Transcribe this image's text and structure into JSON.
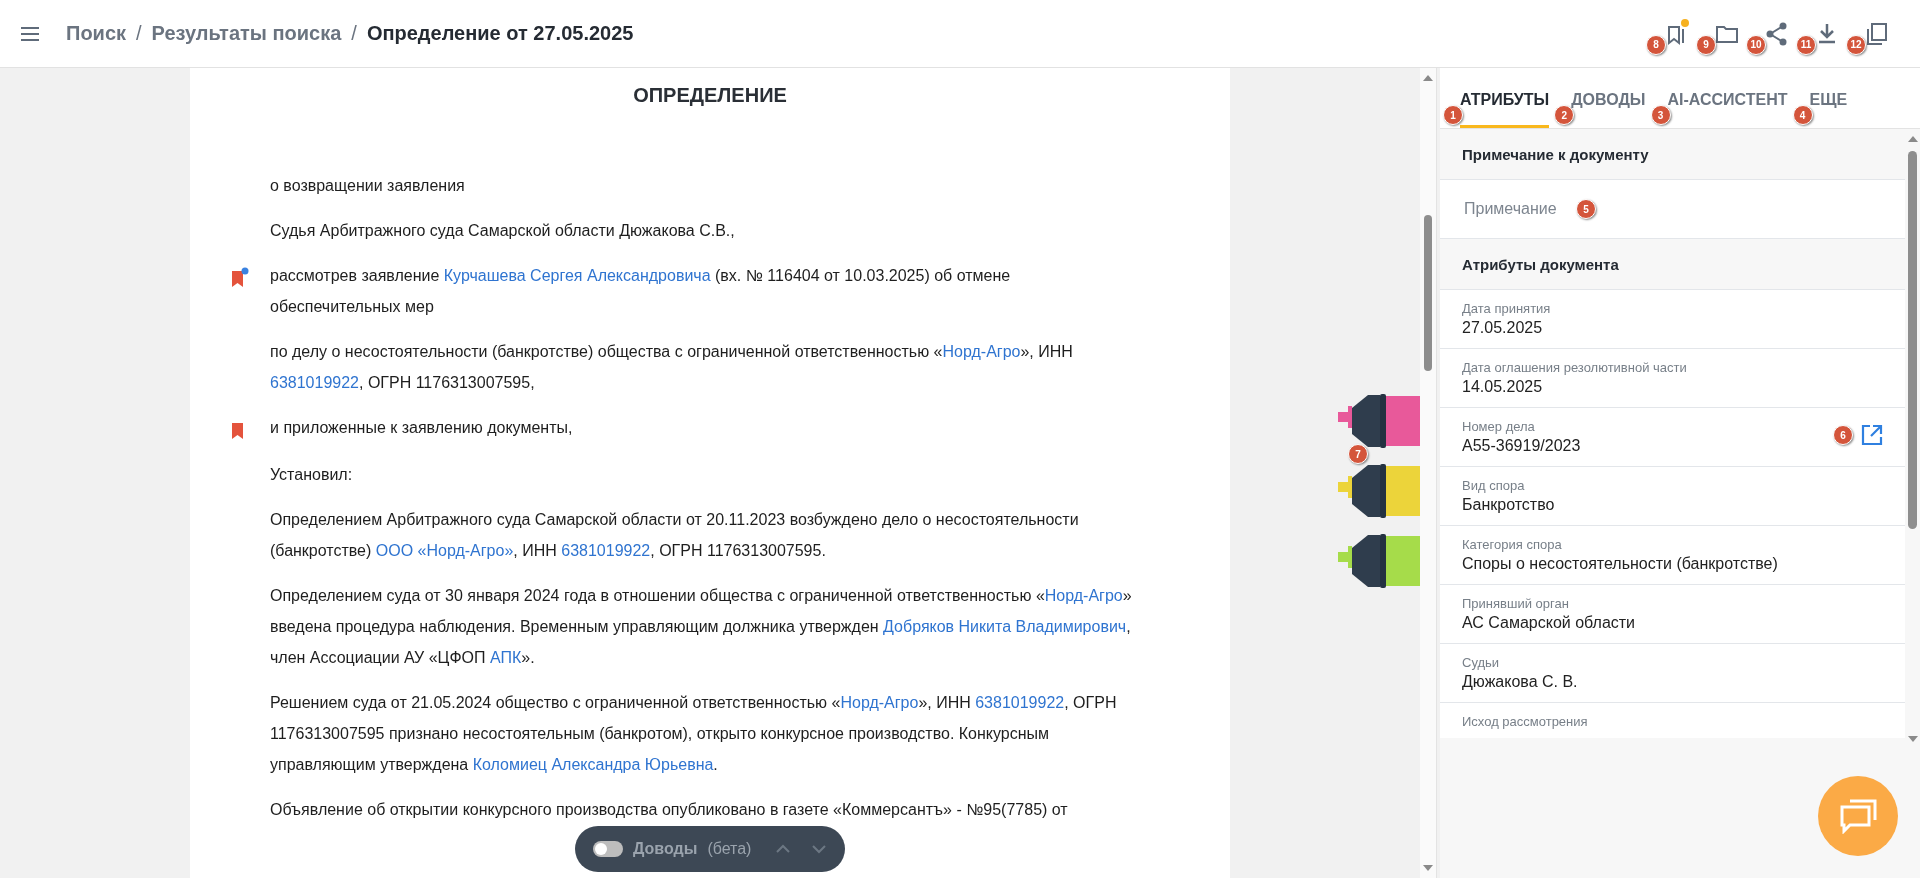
{
  "breadcrumbs": [
    {
      "label": "Поиск",
      "current": false
    },
    {
      "label": "Результаты поиска",
      "current": false
    },
    {
      "label": "Определение от 27.05.2025",
      "current": true
    }
  ],
  "breadcrumb_separator": "/",
  "header_actions": [
    {
      "kind": "bookmark",
      "marker": "8",
      "dot": true
    },
    {
      "kind": "folder",
      "marker": "9"
    },
    {
      "kind": "share",
      "marker": "10"
    },
    {
      "kind": "download",
      "marker": "11"
    },
    {
      "kind": "copy",
      "marker": "12"
    }
  ],
  "document": {
    "title": "ОПРЕДЕЛЕНИЕ",
    "paragraphs": [
      {
        "bookmarked": false,
        "parts": [
          {
            "text": "о возвращении заявления",
            "kind": "text"
          }
        ]
      },
      {
        "bookmarked": false,
        "parts": [
          {
            "text": "Судья Арбитражного суда Самарской области Дюжакова С.В.,",
            "kind": "text"
          }
        ]
      },
      {
        "bookmarked": true,
        "note": true,
        "parts": [
          {
            "text": "рассмотрев заявление ",
            "kind": "text"
          },
          {
            "text": "Курчашева Сергея Александровича",
            "kind": "link"
          },
          {
            "text": " (вх. № 116404 от 10.03.2025) об отмене обеспечительных мер",
            "kind": "text"
          }
        ]
      },
      {
        "bookmarked": false,
        "parts": [
          {
            "text": "по делу о несостоятельности (банкротстве) общества с ограниченной ответственностью «",
            "kind": "text"
          },
          {
            "text": "Норд-Агро",
            "kind": "link"
          },
          {
            "text": "», ИНН ",
            "kind": "text"
          },
          {
            "text": "6381019922",
            "kind": "link"
          },
          {
            "text": ", ОГРН 1176313007595,",
            "kind": "text"
          }
        ]
      },
      {
        "bookmarked": true,
        "note": false,
        "parts": [
          {
            "text": "и приложенные к заявлению документы,",
            "kind": "text"
          }
        ]
      },
      {
        "bookmarked": false,
        "parts": [
          {
            "text": "Установил:",
            "kind": "text"
          }
        ]
      },
      {
        "bookmarked": false,
        "parts": [
          {
            "text": "Определением Арбитражного суда Самарской области от 20.11.2023 возбуждено дело о несостоятельности (банкротстве) ",
            "kind": "text"
          },
          {
            "text": "ООО «Норд-Агро»",
            "kind": "link"
          },
          {
            "text": ", ИНН ",
            "kind": "text"
          },
          {
            "text": "6381019922",
            "kind": "link"
          },
          {
            "text": ", ОГРН 1176313007595.",
            "kind": "text"
          }
        ]
      },
      {
        "bookmarked": false,
        "parts": [
          {
            "text": "Определением суда от 30 января 2024 года в отношении общества с ограниченной ответственностью «",
            "kind": "text"
          },
          {
            "text": "Норд-Агро",
            "kind": "link"
          },
          {
            "text": "» введена процедура наблюдения. Временным управляющим должника утвержден ",
            "kind": "text"
          },
          {
            "text": "Добряков Никита Владимирович",
            "kind": "link"
          },
          {
            "text": ", член Ассоциации АУ «ЦФОП ",
            "kind": "text"
          },
          {
            "text": "АПК",
            "kind": "link"
          },
          {
            "text": "».",
            "kind": "text"
          }
        ]
      },
      {
        "bookmarked": false,
        "parts": [
          {
            "text": "Решением суда от 21.05.2024 общество с ограниченной ответственностью «",
            "kind": "text"
          },
          {
            "text": "Норд-Агро",
            "kind": "link"
          },
          {
            "text": "», ИНН ",
            "kind": "text"
          },
          {
            "text": "6381019922",
            "kind": "link"
          },
          {
            "text": ", ОГРН 1176313007595 признано несостоятельным (банкротом), открыто конкурсное производство. Конкурсным управляющим утверждена ",
            "kind": "text"
          },
          {
            "text": "Коломиец Александра Юрьевна",
            "kind": "link"
          },
          {
            "text": ".",
            "kind": "text"
          }
        ]
      },
      {
        "bookmarked": false,
        "parts": [
          {
            "text": "Объявление об открытии конкурсного производства опубликовано в газете «Коммерсантъ» - №95(7785) от",
            "kind": "text"
          }
        ]
      }
    ]
  },
  "highlighters": {
    "marker": "7",
    "items": [
      {
        "color": "#e8599a"
      },
      {
        "color": "#ecd43a"
      },
      {
        "color": "#a6dc4a"
      }
    ]
  },
  "arguments_toolbar": {
    "toggle_on": false,
    "label": "Доводы",
    "suffix": "(бета)"
  },
  "tabs": [
    {
      "label": "АТРИБУТЫ",
      "selected": true,
      "marker": "1"
    },
    {
      "label": "ДОВОДЫ",
      "selected": false,
      "marker": "2"
    },
    {
      "label": "AI-АССИСТЕНТ",
      "selected": false,
      "marker": "3"
    },
    {
      "label": "ЕЩЕ",
      "selected": false,
      "marker": "4"
    }
  ],
  "note_section": {
    "title": "Примечание к документу",
    "placeholder": "Примечание",
    "marker": "5"
  },
  "attributes_section": {
    "title": "Атрибуты документа",
    "fields": [
      {
        "label": "Дата принятия",
        "value": "27.05.2025"
      },
      {
        "label": "Дата оглашения резолютивной части",
        "value": "14.05.2025"
      },
      {
        "label": "Номер дела",
        "value": "А55-36919/2023",
        "link_marker": "6"
      },
      {
        "label": "Вид спора",
        "value": "Банкротство"
      },
      {
        "label": "Категория спора",
        "value": "Споры о несостоятельности (банкротстве)"
      },
      {
        "label": "Принявший орган",
        "value": "АС Самарской области"
      },
      {
        "label": "Судьи",
        "value": "Дюжакова С. В."
      },
      {
        "label": "Исход рассмотрения"
      }
    ]
  }
}
